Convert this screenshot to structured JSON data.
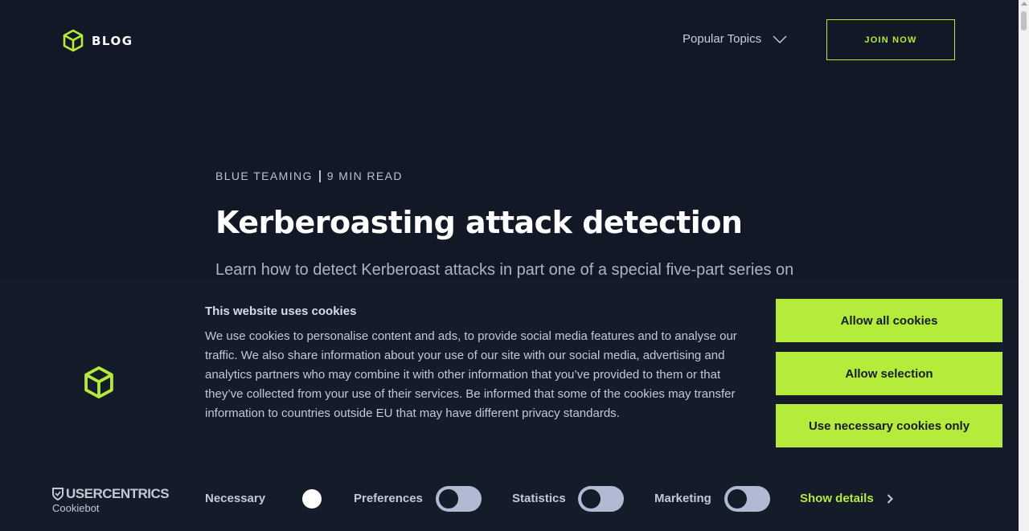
{
  "header": {
    "logo_text": "BLOG",
    "topics_label": "Popular Topics",
    "join_label": "JOIN NOW"
  },
  "article": {
    "category": "BLUE TEAMING",
    "read_time": "9 MIN READ",
    "title": "Kerberoasting attack detection",
    "lead": "Learn how to detect Kerberoast attacks in part one of a special five-part series on"
  },
  "cookie_banner": {
    "title": "This website uses cookies",
    "text": "We use cookies to personalise content and ads, to provide social media features and to analyse our traffic. We also share information about your use of our site with our social media, advertising and analytics partners who may combine it with other information that you’ve provided to them or that they’ve collected from your use of their services. Be informed that some of the cookies may transfer information to countries outside EU that may have different privacy standards.",
    "buttons": {
      "allow_all": "Allow all cookies",
      "allow_selection": "Allow selection",
      "necessary_only": "Use necessary cookies only"
    },
    "toggles": [
      {
        "label": "Necessary",
        "on": true,
        "locked": true
      },
      {
        "label": "Preferences",
        "on": false
      },
      {
        "label": "Statistics",
        "on": false
      },
      {
        "label": "Marketing",
        "on": false
      }
    ],
    "show_details": "Show details",
    "brand_top": "USERCENTRICS",
    "brand_bottom": "Cookiebot"
  },
  "colors": {
    "background": "#121826",
    "banner": "#141c2a",
    "accent": "#b5eb3a"
  },
  "icons": [
    "cube-logo-icon",
    "chevron-down-icon",
    "chevron-right-icon",
    "shield-check-icon"
  ]
}
